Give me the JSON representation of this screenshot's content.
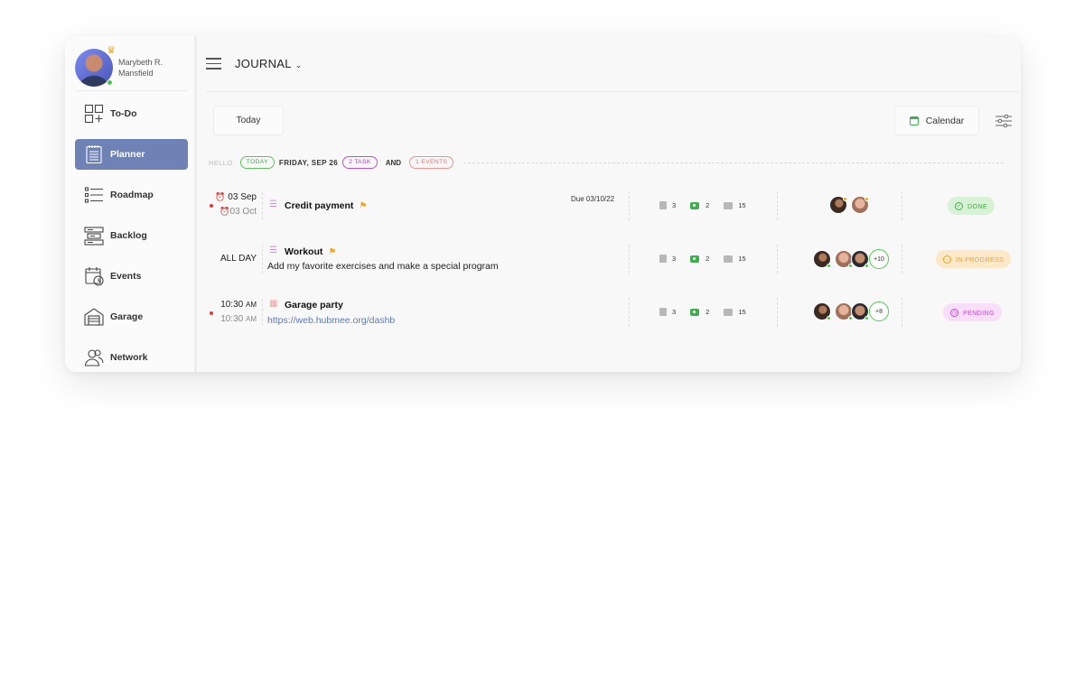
{
  "user": {
    "name": "Marybeth R. Mansfield"
  },
  "nav": [
    {
      "label": "To-Do",
      "icon": "todo-grid-icon"
    },
    {
      "label": "Planner",
      "icon": "planner-notepad-icon",
      "active": true
    },
    {
      "label": "Roadmap",
      "icon": "roadmap-list-icon"
    },
    {
      "label": "Backlog",
      "icon": "backlog-icon"
    },
    {
      "label": "Events",
      "icon": "events-calendar-icon"
    },
    {
      "label": "Garage",
      "icon": "garage-icon"
    },
    {
      "label": "Network",
      "icon": "network-people-icon"
    }
  ],
  "header": {
    "title": "JOURNAL",
    "today_label": "Today",
    "calendar_label": "Calendar"
  },
  "summary": {
    "hello": "HELLO",
    "today_pill": "TODAY",
    "date": "FRIDAY, SEP 26",
    "task_pill": "2 TASK",
    "and": "AND",
    "events_pill": "1 EVENTS"
  },
  "rows": [
    {
      "time_start": "03 Sep",
      "time_end": "03 Oct",
      "title": "Credit payment",
      "due": "Due 03/10/22",
      "docs": "3",
      "photos": "2",
      "comments": "15",
      "status": "DONE"
    },
    {
      "time_start": "ALL DAY",
      "title": "Workout",
      "subtitle": "Add my favorite exercises and make a special program",
      "docs": "3",
      "photos": "2",
      "comments": "15",
      "more": "+10",
      "status": "IN PROGRESS"
    },
    {
      "time_start": "10:30",
      "time_start_ampm": "AM",
      "time_end": "10:30",
      "time_end_ampm": "AM",
      "title": "Garage party",
      "link": "https://web.hubmee.org/dashb",
      "docs": "3",
      "photos": "2",
      "comments": "15",
      "more": "+8",
      "status": "PENDING"
    }
  ],
  "colors": {
    "accent_green": "#3fae4f",
    "active_nav": "#6f82b6",
    "status_done": "#4aa84a",
    "status_progress": "#f3a51d",
    "status_pending": "#c24fd1",
    "link": "#5b7bb8"
  }
}
